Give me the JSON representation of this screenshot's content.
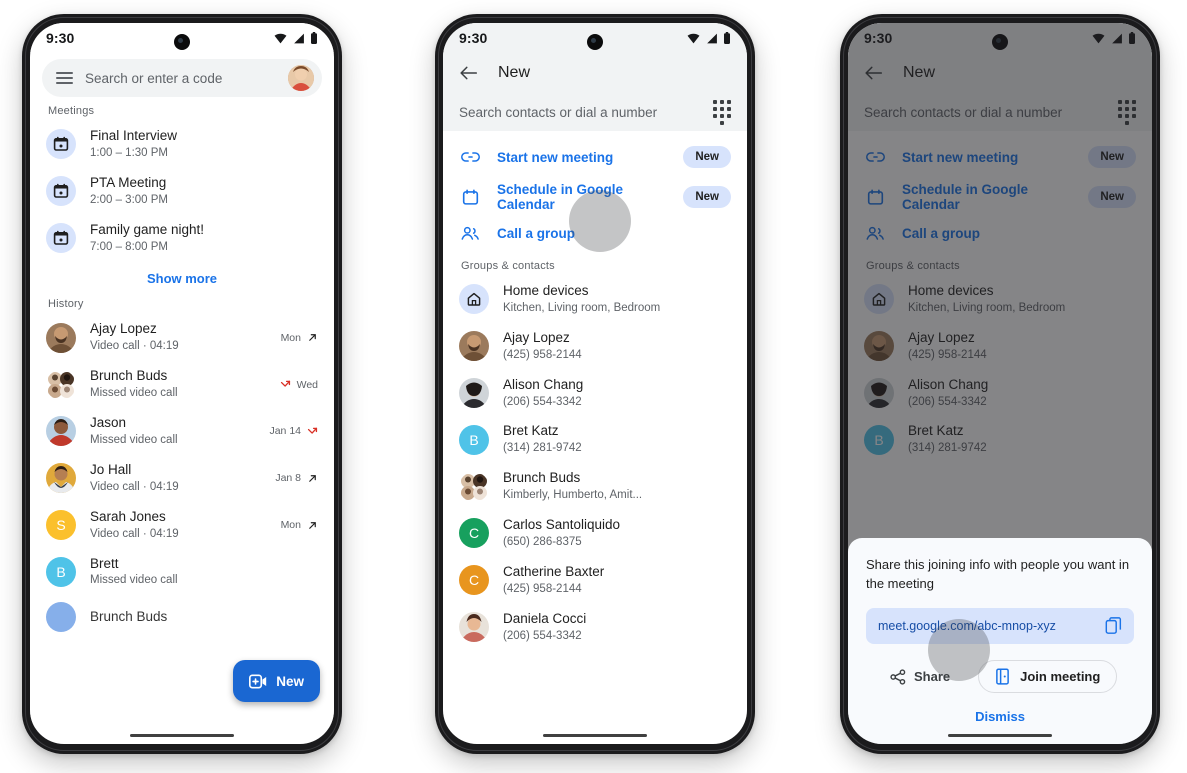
{
  "colors": {
    "accent_blue": "#1a73e8",
    "fab_blue": "#1a67d2",
    "chip_blue": "#d7e3fc",
    "missed_red": "#d93025",
    "text_primary": "#1f1f1f",
    "text_secondary": "#5f6368",
    "surface_grey": "#f1f3f4",
    "sheet_bg": "#f8fafd"
  },
  "status_bar": {
    "time": "9:30",
    "icons": [
      "wifi-icon",
      "cellular-signal-icon",
      "battery-icon"
    ]
  },
  "phone1": {
    "search": {
      "menu_icon": "hamburger-menu-icon",
      "placeholder": "Search or enter a code",
      "avatar": "user-avatar"
    },
    "meetings_label": "Meetings",
    "meetings": [
      {
        "icon": "calendar-icon",
        "title": "Final Interview",
        "time": "1:00 – 1:30 PM"
      },
      {
        "icon": "calendar-icon",
        "title": "PTA Meeting",
        "time": "2:00 – 3:00 PM"
      },
      {
        "icon": "calendar-icon",
        "title": "Family game night!",
        "time": "7:00 – 8:00 PM"
      }
    ],
    "show_more": "Show more",
    "history_label": "History",
    "history": [
      {
        "name": "Ajay Lopez",
        "detail": "Video call ·  04:19",
        "date": "Mon",
        "call_icon": "outgoing-call-arrow-icon",
        "missed": false,
        "icon_side": "right",
        "avatar_type": "photo",
        "avatar_color": "#8a6a50",
        "initial": ""
      },
      {
        "name": "Brunch Buds",
        "detail": "Missed video call",
        "date": "Wed",
        "call_icon": "missed-call-arrow-icon",
        "missed": true,
        "icon_side": "left",
        "avatar_type": "group",
        "avatar_color": "#cfc4bb",
        "initial": ""
      },
      {
        "name": "Jason",
        "detail": "Missed video call",
        "date": "Jan 14",
        "call_icon": "missed-call-arrow-icon",
        "missed": true,
        "icon_side": "right",
        "avatar_type": "photo",
        "avatar_color": "#c0392b",
        "initial": ""
      },
      {
        "name": "Jo Hall",
        "detail": "Video call ·  04:19",
        "date": "Jan 8",
        "call_icon": "outgoing-call-arrow-icon",
        "missed": false,
        "icon_side": "right",
        "avatar_type": "photo",
        "avatar_color": "#e0a93b",
        "initial": ""
      },
      {
        "name": "Sarah Jones",
        "detail": "Video call ·  04:19",
        "date": "Mon",
        "call_icon": "outgoing-call-arrow-icon",
        "missed": false,
        "icon_side": "right",
        "avatar_type": "initial",
        "avatar_color": "#fbc02d",
        "initial": "S"
      },
      {
        "name": "Brett",
        "detail": "Missed video call",
        "date": "",
        "call_icon": "",
        "missed": false,
        "icon_side": "right",
        "avatar_type": "initial",
        "avatar_color": "#4fc3e8",
        "initial": "B"
      },
      {
        "name": "Brunch Buds",
        "detail": "",
        "date": "",
        "call_icon": "",
        "missed": false,
        "icon_side": "right",
        "avatar_type": "initial",
        "avatar_color": "#7aa7e8",
        "initial": ""
      }
    ],
    "fab": {
      "label": "New",
      "icon": "new-video-call-icon"
    }
  },
  "phone2": {
    "appbar": {
      "back_icon": "back-arrow-icon",
      "title": "New"
    },
    "search": {
      "placeholder": "Search contacts or dial a number",
      "dialpad_icon": "dialpad-icon"
    },
    "actions": [
      {
        "icon": "link-icon",
        "label": "Start new meeting",
        "badge": "New"
      },
      {
        "icon": "calendar-icon",
        "label": "Schedule in Google Calendar",
        "badge": "New"
      },
      {
        "icon": "group-icon",
        "label": "Call a group",
        "badge": ""
      }
    ],
    "contacts_label": "Groups & contacts",
    "contacts": [
      {
        "name": "Home devices",
        "detail": "Kitchen, Living room, Bedroom",
        "avatar_type": "home",
        "avatar_color": "#d7e3fc",
        "initial": ""
      },
      {
        "name": "Ajay Lopez",
        "detail": "(425) 958-2144",
        "avatar_type": "photo",
        "avatar_color": "#8a6a50",
        "initial": ""
      },
      {
        "name": "Alison Chang",
        "detail": "(206) 554-3342",
        "avatar_type": "photo",
        "avatar_color": "#6d5b4f",
        "initial": ""
      },
      {
        "name": "Bret Katz",
        "detail": "(314) 281-9742",
        "avatar_type": "initial",
        "avatar_color": "#4fc3e8",
        "initial": "B"
      },
      {
        "name": "Brunch Buds",
        "detail": "Kimberly, Humberto, Amit...",
        "avatar_type": "group",
        "avatar_color": "#cfc4bb",
        "initial": ""
      },
      {
        "name": "Carlos Santoliquido",
        "detail": "(650) 286-8375",
        "avatar_type": "initial",
        "avatar_color": "#17a05e",
        "initial": "C"
      },
      {
        "name": "Catherine Baxter",
        "detail": "(425) 958-2144",
        "avatar_type": "initial",
        "avatar_color": "#e8951e",
        "initial": "C"
      },
      {
        "name": "Daniela Cocci",
        "detail": "(206) 554-3342",
        "avatar_type": "photo",
        "avatar_color": "#c96a5e",
        "initial": ""
      }
    ],
    "tap_indicator": {
      "target": "Schedule in Google Calendar"
    }
  },
  "phone3": {
    "appbar": {
      "back_icon": "back-arrow-icon",
      "title": "New"
    },
    "search": {
      "placeholder": "Search contacts or dial a number",
      "dialpad_icon": "dialpad-icon"
    },
    "actions": [
      {
        "icon": "link-icon",
        "label": "Start new meeting",
        "badge": "New"
      },
      {
        "icon": "calendar-icon",
        "label": "Schedule in Google Calendar",
        "badge": "New"
      },
      {
        "icon": "group-icon",
        "label": "Call a group",
        "badge": ""
      }
    ],
    "contacts_label": "Groups & contacts",
    "contacts": [
      {
        "name": "Home devices",
        "detail": "Kitchen, Living room, Bedroom",
        "avatar_type": "home",
        "avatar_color": "#d7e3fc",
        "initial": ""
      },
      {
        "name": "Ajay Lopez",
        "detail": "(425) 958-2144",
        "avatar_type": "photo",
        "avatar_color": "#8a6a50",
        "initial": ""
      },
      {
        "name": "Alison Chang",
        "detail": "(206) 554-3342",
        "avatar_type": "photo",
        "avatar_color": "#6d5b4f",
        "initial": ""
      },
      {
        "name": "Bret Katz",
        "detail": "(314) 281-9742",
        "avatar_type": "initial",
        "avatar_color": "#4fc3e8",
        "initial": "B"
      }
    ],
    "dialog": {
      "message": "Share this joining info with people you want in the meeting",
      "link": "meet.google.com/abc-mnop-xyz",
      "copy_icon": "copy-icon",
      "share_button": {
        "label": "Share",
        "icon": "share-icon"
      },
      "join_button": {
        "label": "Join meeting",
        "icon": "join-door-icon"
      },
      "dismiss": "Dismiss"
    },
    "tap_indicator": {
      "target": "Share"
    }
  }
}
